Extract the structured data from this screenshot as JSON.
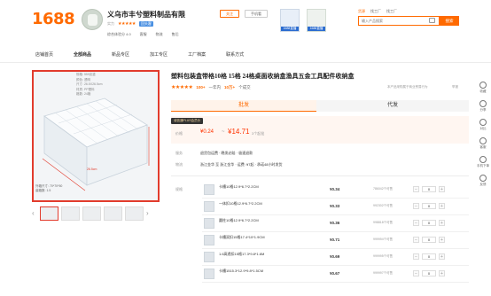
{
  "header": {
    "logo": "1688",
    "shop_name": "义乌市丰兮塑料制品有限",
    "follow": "关注",
    "contact": "手机看",
    "shop_sub": {
      "tag": "实力",
      "stars": "★★★★★",
      "rank": "回头客"
    },
    "shop_links": [
      "综合体验分 4.0",
      "客服",
      "物流",
      "售后"
    ],
    "promo_thumbs": [
      "1688直播",
      "1688直播"
    ],
    "search_tabs": [
      "货源",
      "找工厂",
      "找工厂"
    ],
    "search_placeholder": "输入产品搜索",
    "search_button": "搜索"
  },
  "nav": [
    "店铺首页",
    "全部商品",
    "新品专区",
    "加工专区",
    "工厂档案",
    "联系方式"
  ],
  "image": {
    "spec_lines": [
      "规格: 559克重",
      "颜色: 透明",
      "尺寸: 26.5X26.5cm",
      "材质: PP塑料",
      "格数: 24格"
    ],
    "bottom_lines": [
      "外箱尺寸: 70*70*50",
      "装箱数: 1.5"
    ],
    "dimension_text": "26.5cm"
  },
  "product": {
    "title": "塑料包装盒带格10格 15格 24格桌面收纳盒渔具五金工具配件收纳盒",
    "rating_stars": "★★★★★",
    "reviews": "100+",
    "sold_prefix": "一年内",
    "sold": "10万+",
    "sold_suffix": "个成交",
    "right_note": "本产品采购属于商业贸易行为",
    "share": "举报",
    "tab_wholesale": "批发",
    "tab_agent": "代发",
    "plus_tag": "诚信通PLUS会员价",
    "price_label": "价格",
    "price_low": "¥0.24",
    "price_sep": "~",
    "price_high": "¥14.71",
    "price_unit": "3个起批",
    "service_label": "服务",
    "service_value": "退货包运费 · 晚发必赔 · 极速退款",
    "ship_label": "物流",
    "ship_value": "浙江金华 至 浙江金华 · 运费: ¥7起 · 承诺48小时发货",
    "spec_label": "规格"
  },
  "variants": [
    {
      "name": "卡槽10格12.9*6.7*2.2CM",
      "price": "¥0.34",
      "stock": "786042个可售",
      "qty": "0"
    },
    {
      "name": "一体扣10格12.9*6.7*2.2CM",
      "price": "¥0.33",
      "stock": "992302个可售",
      "qty": "0"
    },
    {
      "name": "圆柱10格12.9*6.7*2.2CM",
      "price": "¥0.36",
      "stock": "998818个可售",
      "qty": "0"
    },
    {
      "name": "卡槽双扣15格17.4*10*1.9CM",
      "price": "¥0.71",
      "stock": "999994个可售",
      "qty": "0"
    },
    {
      "name": "1.6高透扣15格17.3*9.8*1.6M",
      "price": "¥0.69",
      "stock": "999995个可售",
      "qty": "0"
    },
    {
      "name": "卡槽1515.3*12.9*9.8*1.5CM",
      "price": "¥0.67",
      "stock": "999997个可售",
      "qty": "0"
    }
  ],
  "sidebar": [
    "收藏",
    "分享",
    "对比",
    "客服",
    "手机下单",
    "反馈"
  ]
}
